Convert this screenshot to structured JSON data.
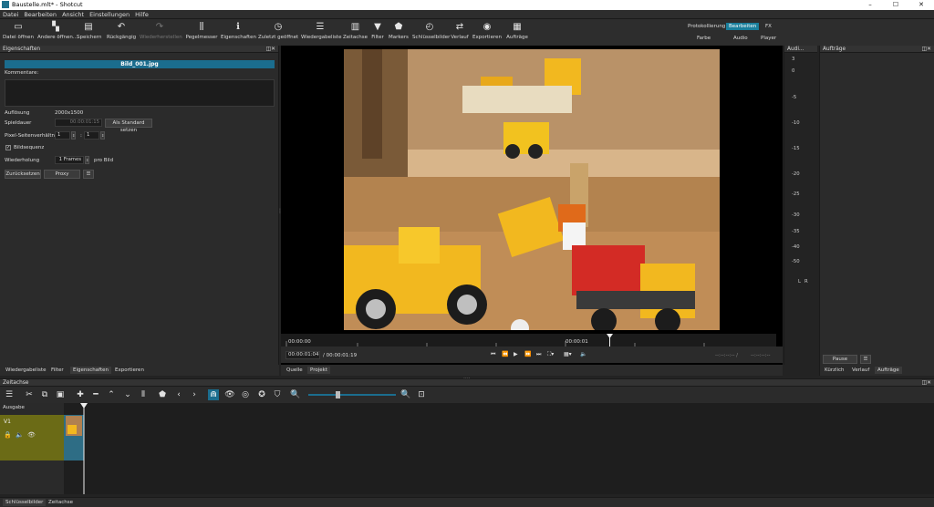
{
  "window": {
    "title": "Baustelle.mlt* - Shotcut",
    "minimize": "–",
    "maximize": "☐",
    "close": "✕"
  },
  "menu": [
    "Datei",
    "Bearbeiten",
    "Ansicht",
    "Einstellungen",
    "Hilfe"
  ],
  "toolbar": [
    {
      "label": "Datei öffnen",
      "icon": "folder-icon",
      "glyph": "▭"
    },
    {
      "label": "Andere öffnen...",
      "icon": "open-other-icon",
      "glyph": "▚"
    },
    {
      "label": "Speichern",
      "icon": "save-icon",
      "glyph": "▤"
    },
    {
      "label": "Rückgängig",
      "icon": "undo-icon",
      "glyph": "↶"
    },
    {
      "label": "Wiederherstellen",
      "icon": "redo-icon",
      "glyph": "↷"
    },
    {
      "label": "Pegelmesser",
      "icon": "meter-icon",
      "glyph": "⫼"
    },
    {
      "label": "Eigenschaften",
      "icon": "info-icon",
      "glyph": "ℹ"
    },
    {
      "label": "Zuletzt geöffnet",
      "icon": "clock-icon",
      "glyph": "◷"
    },
    {
      "label": "Wiedergabeliste",
      "icon": "playlist-icon",
      "glyph": "☰"
    },
    {
      "label": "Zeitachse",
      "icon": "timeline-icon",
      "glyph": "▥"
    },
    {
      "label": "Filter",
      "icon": "filter-icon",
      "glyph": "▼"
    },
    {
      "label": "Markers",
      "icon": "marker-icon",
      "glyph": "⬟"
    },
    {
      "label": "Schlüsselbilder",
      "icon": "stopwatch-icon",
      "glyph": "◴"
    },
    {
      "label": "Verlauf",
      "icon": "history-icon",
      "glyph": "⇄"
    },
    {
      "label": "Exportieren",
      "icon": "export-icon",
      "glyph": "◉"
    },
    {
      "label": "Aufträge",
      "icon": "jobs-icon",
      "glyph": "▦"
    }
  ],
  "layouts": {
    "row1": [
      "Protokollierung",
      "Bearbeiten",
      "FX"
    ],
    "row2": [
      "Farbe",
      "Audio",
      "Player"
    ],
    "active": "Bearbeiten"
  },
  "properties": {
    "header": "Eigenschaften",
    "clip_name": "Bild_001.jpg",
    "comments_label": "Kommentare:",
    "resolution_label": "Auflösung",
    "resolution_value": "2000x1500",
    "duration_label": "Spieldauer",
    "duration_value": "00:00:01:15",
    "set_default": "Als Standard setzen",
    "par_label": "Pixel-Seitenverhältnis",
    "par_num": "1",
    "par_sep": ":",
    "par_den": "1",
    "sequence_label": "Bildsequenz",
    "repeat_label": "Wiederholung",
    "repeat_value": "1 Frames",
    "repeat_suffix": "pro Bild",
    "reset": "Zurücksetzen",
    "proxy": "Proxy",
    "menu": "☰"
  },
  "left_tabs": [
    "Wiedergabeliste",
    "Filter",
    "Eigenschaften",
    "Exportieren"
  ],
  "left_tab_active": "Eigenschaften",
  "viewer": {
    "ruler_start": "00:00:00",
    "ruler_mid": "00:00:01",
    "position": "00:00:01:04",
    "duration": "/ 00:00:01:19",
    "in_out": "--:--:--:-- /",
    "in_out2": "--:--:--:--",
    "tabs": [
      "Quelle",
      "Projekt"
    ]
  },
  "audio_meter": {
    "title": "Audi...",
    "ticks": [
      "3",
      "0",
      "-5",
      "-10",
      "-15",
      "-20",
      "-25",
      "-30",
      "-35",
      "-40",
      "-50"
    ],
    "left": "L",
    "right": "R"
  },
  "jobs": {
    "title": "Aufträge",
    "pause": "Pause",
    "menu": "☰",
    "tabs": [
      "Kürzlich",
      "Verlauf",
      "Aufträge"
    ]
  },
  "timeline": {
    "header": "Zeitachse",
    "output_label": "Ausgabe",
    "track": "V1"
  },
  "status_tabs": [
    "Schlüsselbilder",
    "Zeitachse"
  ],
  "colors": {
    "accent": "#1b6d8e",
    "track": "#6b6b16"
  }
}
